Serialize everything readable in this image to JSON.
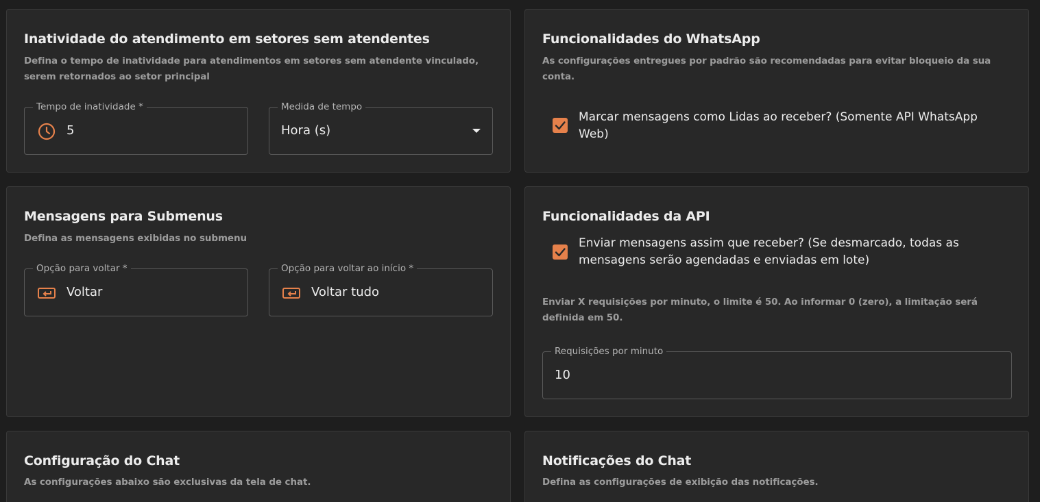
{
  "colors": {
    "accent": "#e6814b",
    "background": "#1e1e1e",
    "card": "#282828"
  },
  "inactivity": {
    "title": "Inatividade do atendimento em setores sem atendentes",
    "description": "Defina o tempo de inatividade para atendimentos em setores sem atendente vinculado, serem retornados ao setor principal",
    "time_field": {
      "label": "Tempo de inatividade *",
      "value": "5",
      "icon": "clock-icon"
    },
    "unit_field": {
      "label": "Medida de tempo",
      "value": "Hora (s)"
    }
  },
  "whatsapp": {
    "title": "Funcionalidades do WhatsApp",
    "description": "As configurações entregues por padrão são recomendadas para evitar bloqueio da sua conta.",
    "mark_read": {
      "label": "Marcar mensagens como Lidas ao receber? (Somente API WhatsApp Web)",
      "checked": true
    }
  },
  "submenus": {
    "title": "Mensagens para Submenus",
    "description": "Defina as mensagens exibidas no submenu",
    "back_field": {
      "label": "Opção para voltar *",
      "value": "Voltar",
      "icon": "keyboard-return-icon"
    },
    "back_all_field": {
      "label": "Opção para voltar ao início *",
      "value": "Voltar tudo",
      "icon": "keyboard-return-icon"
    }
  },
  "api": {
    "title": "Funcionalidades da API",
    "send_immediately": {
      "label": "Enviar mensagens assim que receber? (Se desmarcado, todas as mensagens serão agendadas e enviadas em lote)",
      "checked": true
    },
    "rate_description": "Enviar X requisições por minuto, o limite é 50. Ao informar 0 (zero), a limitação será definida em 50.",
    "rate_field": {
      "label": "Requisições por minuto",
      "value": "10"
    }
  },
  "chat_config": {
    "title": "Configuração do Chat",
    "description": "As configurações abaixo são exclusivas da tela de chat."
  },
  "chat_notifications": {
    "title": "Notificações do Chat",
    "description": "Defina as configurações de exibição das notificações."
  }
}
